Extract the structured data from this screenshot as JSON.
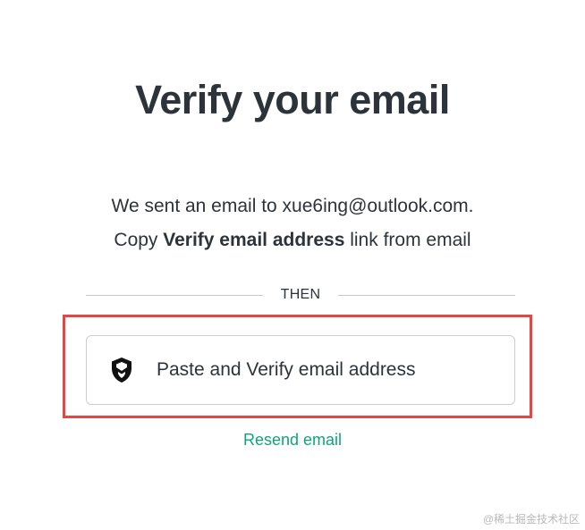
{
  "page": {
    "title": "Verify your email",
    "message_line1": "We sent an email to xue6ing@outlook.com.",
    "message_line2_prefix": "Copy ",
    "message_line2_bold": "Verify email address",
    "message_line2_suffix": " link from email",
    "divider_text": "THEN",
    "paste_button": {
      "icon": "shield-icon",
      "label": "Paste and Verify email address"
    },
    "resend_link": "Resend email"
  },
  "watermark": "@稀土掘金技术社区",
  "colors": {
    "text": "#2d333a",
    "link": "#10a37f",
    "highlight_border": "#e04848",
    "divider": "#c2c8d0"
  }
}
